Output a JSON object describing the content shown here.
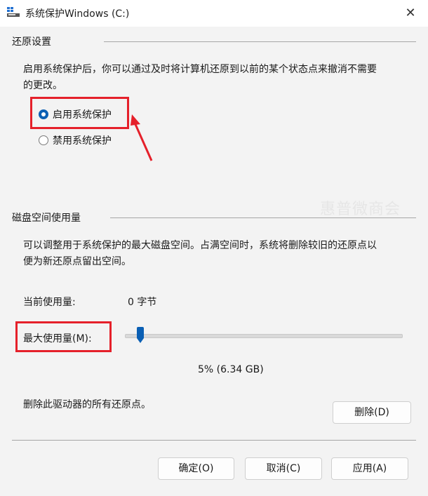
{
  "window": {
    "title": "系统保护Windows (C:)",
    "close_glyph": "✕"
  },
  "restore": {
    "section_title": "还原设置",
    "description_line1": "启用系统保护后，你可以通过及时将计算机还原到以前的某个状态点来撤消不需要",
    "description_line2": "的更改。",
    "options": [
      {
        "label": "启用系统保护",
        "checked": true
      },
      {
        "label": "禁用系统保护",
        "checked": false
      }
    ]
  },
  "disk": {
    "section_title": "磁盘空间使用量",
    "description_line1": "可以调整用于系统保护的最大磁盘空间。占满空间时，系统将删除较旧的还原点以",
    "description_line2": "便为新还原点留出空间。",
    "current_label": "当前使用量:",
    "current_value": "0 字节",
    "max_label": "最大使用量(M):",
    "max_value_text": "5% (6.34 GB)",
    "max_percent": 5
  },
  "delete": {
    "description": "删除此驱动器的所有还原点。",
    "button_label": "删除(D)"
  },
  "footer": {
    "ok_label": "确定(O)",
    "cancel_label": "取消(C)",
    "apply_label": "应用(A)"
  },
  "watermark": "惠普微商会",
  "colors": {
    "accent": "#0a5fb4",
    "highlight": "#e5202a"
  }
}
